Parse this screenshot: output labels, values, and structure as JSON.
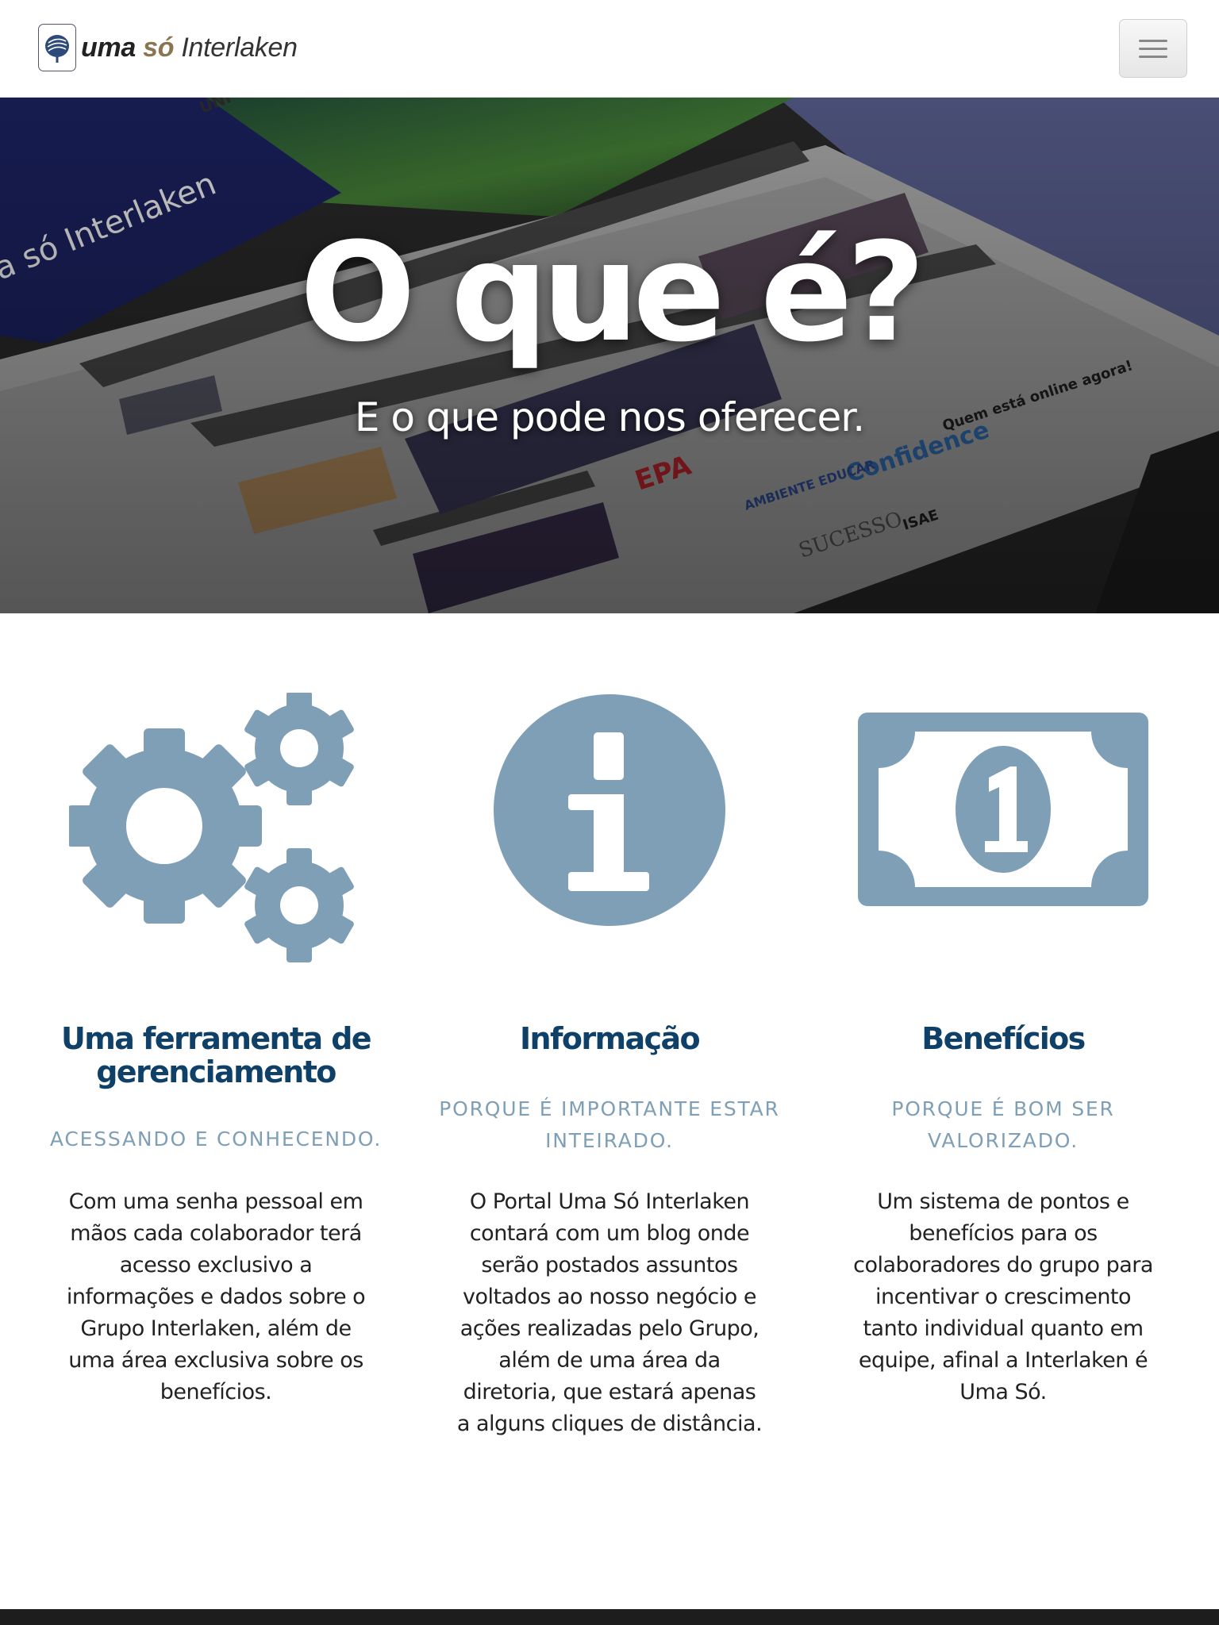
{
  "brand": {
    "part1": "uma",
    "part2": "só",
    "part3": "Interlaken",
    "logo_icon": "tree-logo-icon"
  },
  "nav": {
    "menu_icon": "hamburger-icon"
  },
  "hero": {
    "title": "O que é?",
    "subtitle": "E o que pode nos oferecer."
  },
  "features": [
    {
      "icon": "gears-icon",
      "title": "Uma ferramenta de gerenciamento",
      "subtitle": "ACESSANDO E CONHECENDO.",
      "text": "Com uma senha pessoal em mãos cada colaborador terá acesso exclusivo a informações e dados sobre o Grupo Interlaken, além de uma área exclusiva sobre os benefícios."
    },
    {
      "icon": "info-circle-icon",
      "title": "Informação",
      "subtitle": "PORQUE É IMPORTANTE ESTAR INTEIRADO.",
      "text": "O Portal Uma Só Interlaken contará com um blog onde serão postados assuntos voltados ao nosso negócio e ações realizadas pelo Grupo, além de uma área da diretoria, que estará apenas a alguns cliques de distância."
    },
    {
      "icon": "money-bill-icon",
      "title": "Benefícios",
      "subtitle": "PORQUE É BOM SER VALORIZADO.",
      "text": "Um sistema de pontos e benefícios para os colaboradores do grupo para incentivar o crescimento tanto individual quanto em equipe, afinal a Interlaken é Uma Só."
    }
  ],
  "colors": {
    "icon_color": "#7f9fb6",
    "heading_color": "#0e4068",
    "subheading_color": "#7f9fb6"
  }
}
